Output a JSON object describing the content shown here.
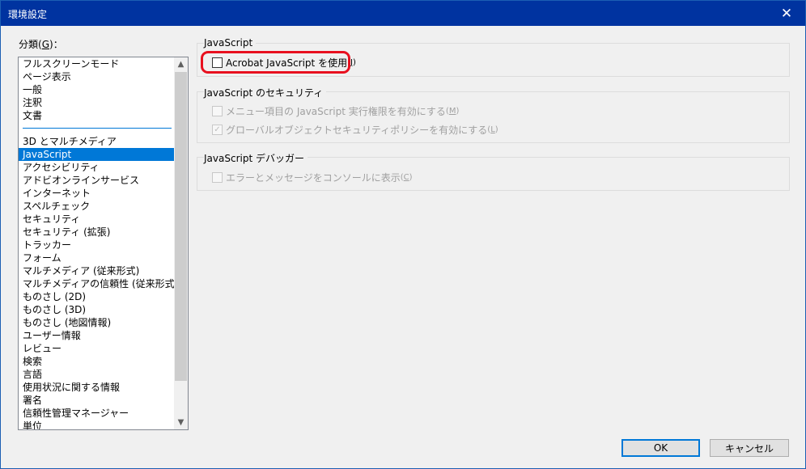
{
  "window": {
    "title": "環境設定",
    "close_glyph": "✕"
  },
  "categories": {
    "label": "分類",
    "label_key": "G",
    "label_suffix": "：",
    "items": [
      "フルスクリーンモード",
      "ページ表示",
      "一般",
      "注釈",
      "文書",
      "",
      "3D とマルチメディア",
      "JavaScript",
      "アクセシビリティ",
      "アドビオンラインサービス",
      "インターネット",
      "スペルチェック",
      "セキュリティ",
      "セキュリティ (拡張)",
      "トラッカー",
      "フォーム",
      "マルチメディア (従来形式)",
      "マルチメディアの信頼性 (従来形式)",
      "ものさし (2D)",
      "ものさし (3D)",
      "ものさし (地図情報)",
      "ユーザー情報",
      "レビュー",
      "検索",
      "言語",
      "使用状況に関する情報",
      "署名",
      "信頼性管理マネージャー",
      "単位"
    ],
    "selected_index": 7,
    "separator_index": 5
  },
  "scroll": {
    "up_glyph": "▲",
    "down_glyph": "▼"
  },
  "groups": {
    "javascript": {
      "title": "JavaScript",
      "enable": {
        "label": "Acrobat JavaScript を使用",
        "key": "J",
        "checked": false
      }
    },
    "security": {
      "title": "JavaScript のセキュリティ",
      "menu_privilege": {
        "label": "メニュー項目の JavaScript 実行権限を有効にする",
        "key": "M",
        "checked": false
      },
      "global_object": {
        "label": "グローバルオブジェクトセキュリティポリシーを有効にする",
        "key": "L",
        "checked": true
      }
    },
    "debugger": {
      "title": "JavaScript デバッガー",
      "console": {
        "label": "エラーとメッセージをコンソールに表示",
        "key": "C",
        "checked": false
      }
    }
  },
  "buttons": {
    "ok": "OK",
    "cancel": "キャンセル"
  },
  "colors": {
    "titlebar": "#0033a0",
    "selection": "#0078d7",
    "highlight_ring": "#e8101f"
  }
}
